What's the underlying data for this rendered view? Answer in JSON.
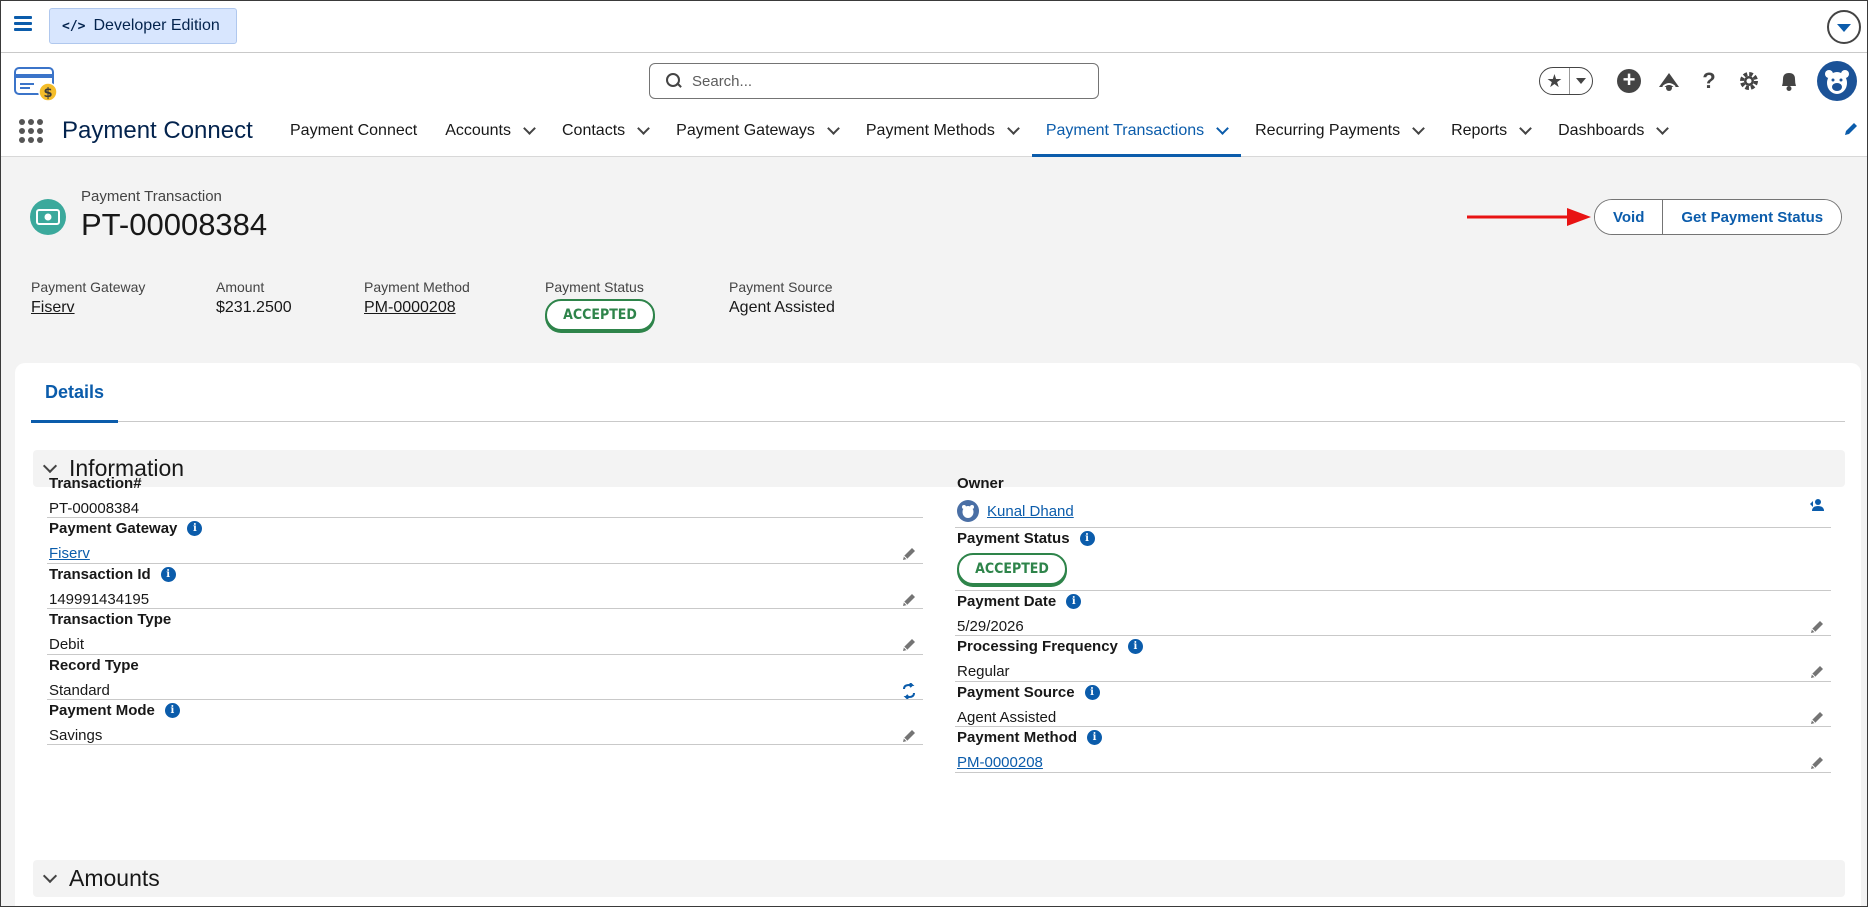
{
  "devbar": {
    "edition_label": "Developer Edition",
    "code_glyph": "</>"
  },
  "search": {
    "placeholder": "Search..."
  },
  "app": {
    "name": "Payment Connect"
  },
  "nav": [
    {
      "label": "Payment Connect",
      "has_menu": false,
      "active": false
    },
    {
      "label": "Accounts",
      "has_menu": true,
      "active": false
    },
    {
      "label": "Contacts",
      "has_menu": true,
      "active": false
    },
    {
      "label": "Payment Gateways",
      "has_menu": true,
      "active": false
    },
    {
      "label": "Payment Methods",
      "has_menu": true,
      "active": false
    },
    {
      "label": "Payment Transactions",
      "has_menu": true,
      "active": true
    },
    {
      "label": "Recurring Payments",
      "has_menu": true,
      "active": false
    },
    {
      "label": "Reports",
      "has_menu": true,
      "active": false
    },
    {
      "label": "Dashboards",
      "has_menu": true,
      "active": false
    }
  ],
  "record": {
    "object_label": "Payment Transaction",
    "title": "PT-00008384",
    "actions": {
      "void": "Void",
      "get_status": "Get Payment Status"
    }
  },
  "highlights": [
    {
      "label": "Payment Gateway",
      "value": "Fiserv",
      "type": "link"
    },
    {
      "label": "Amount",
      "value": "$231.2500",
      "type": "text"
    },
    {
      "label": "Payment Method",
      "value": "PM-0000208",
      "type": "link"
    },
    {
      "label": "Payment Status",
      "value": "ACCEPTED",
      "type": "badge"
    },
    {
      "label": "Payment Source",
      "value": "Agent Assisted",
      "type": "text"
    }
  ],
  "tabs": {
    "details": "Details"
  },
  "sections": {
    "information": "Information",
    "amounts": "Amounts"
  },
  "left_fields": [
    {
      "label": "Transaction#",
      "value": "PT-00008384",
      "info": false,
      "type": "text",
      "action": "none"
    },
    {
      "label": "Payment Gateway",
      "value": "Fiserv",
      "info": true,
      "type": "link",
      "action": "edit"
    },
    {
      "label": "Transaction Id",
      "value": "149991434195",
      "info": true,
      "type": "text",
      "action": "edit"
    },
    {
      "label": "Transaction Type",
      "value": "Debit",
      "info": false,
      "type": "text",
      "action": "edit"
    },
    {
      "label": "Record Type",
      "value": "Standard",
      "info": false,
      "type": "text",
      "action": "change-record-type"
    },
    {
      "label": "Payment Mode",
      "value": "Savings",
      "info": true,
      "type": "text",
      "action": "edit"
    }
  ],
  "right_fields": [
    {
      "label": "Owner",
      "value": "Kunal Dhand",
      "info": false,
      "type": "owner",
      "action": "change-owner"
    },
    {
      "label": "Payment Status",
      "value": "ACCEPTED",
      "info": true,
      "type": "badge",
      "action": "none"
    },
    {
      "label": "Payment Date",
      "value": "5/29/2026",
      "info": true,
      "type": "text",
      "action": "edit"
    },
    {
      "label": "Processing Frequency",
      "value": "Regular",
      "info": true,
      "type": "text",
      "action": "edit"
    },
    {
      "label": "Payment Source",
      "value": "Agent Assisted",
      "info": true,
      "type": "text",
      "action": "edit"
    },
    {
      "label": "Payment Method",
      "value": "PM-0000208",
      "info": true,
      "type": "link",
      "action": "edit"
    }
  ],
  "colors": {
    "brand": "#0b5cab",
    "accepted": "#2e844a",
    "record_icon": "#3ba99c",
    "annotation_arrow": "#e81313"
  }
}
